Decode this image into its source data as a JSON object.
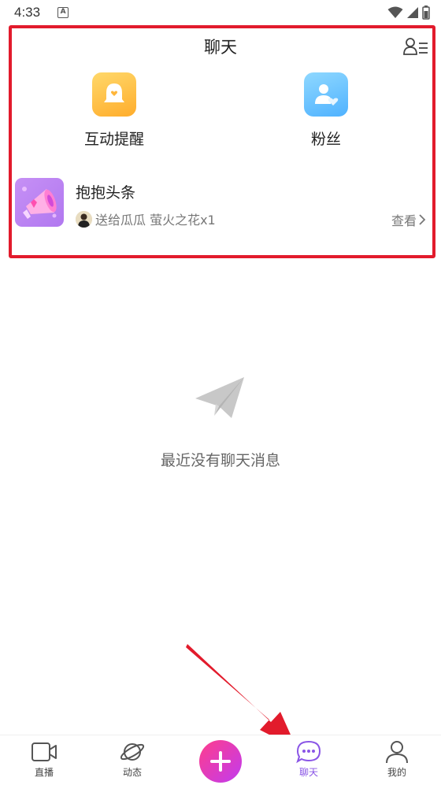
{
  "status_bar": {
    "time": "4:33"
  },
  "header": {
    "title": "聊天"
  },
  "quick_entries": [
    {
      "label": "互动提醒",
      "icon": "bell-heart-icon"
    },
    {
      "label": "粉丝",
      "icon": "user-heart-icon"
    }
  ],
  "headline": {
    "title": "抱抱头条",
    "subtitle": "送给瓜瓜 萤火之花x1",
    "view_label": "查看"
  },
  "empty_state": {
    "text": "最近没有聊天消息"
  },
  "tabs": [
    {
      "label": "直播",
      "icon": "video-icon"
    },
    {
      "label": "动态",
      "icon": "planet-icon"
    },
    {
      "label": "聊天",
      "icon": "chat-bubble-icon",
      "active": true
    },
    {
      "label": "我的",
      "icon": "person-icon"
    }
  ],
  "colors": {
    "accent": "#8a55e6",
    "highlight": "#e21b2c"
  }
}
